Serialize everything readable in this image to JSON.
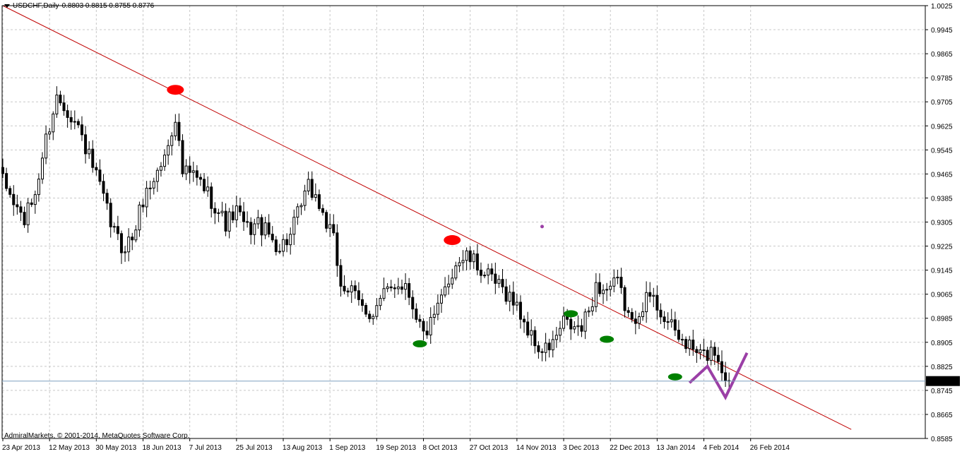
{
  "header": {
    "symbol": "USDCHF,Daily",
    "ohlc": "0.8803 0.8815 0.8755 0.8776"
  },
  "footer": {
    "copyright": "AdmiralMarkets, © 2001-2014, MetaQuotes Software Corp."
  },
  "colors": {
    "background": "#ffffff",
    "grid": "#c8c8c8",
    "candle": "#000000",
    "trendline": "#c00000",
    "resistance_marker": "#ff0000",
    "support_marker": "#008000",
    "projection": "#9b3fa6",
    "price_line": "#7f9fbf",
    "price_label_bg": "#000000",
    "price_label_text": "#ffffff"
  },
  "chart_data": {
    "type": "candlestick",
    "symbol": "USDCHF",
    "timeframe": "Daily",
    "current_price": "0.8776",
    "grid": true,
    "ylim": [
      0.8585,
      1.0025
    ],
    "y_ticks": [
      "1.0025",
      "0.9945",
      "0.9865",
      "0.9785",
      "0.9705",
      "0.9625",
      "0.9545",
      "0.9465",
      "0.9385",
      "0.9305",
      "0.9225",
      "0.9145",
      "0.9065",
      "0.8985",
      "0.8905",
      "0.8825",
      "0.8745",
      "0.8665",
      "0.8585"
    ],
    "x_ticks": [
      "23 Apr 2013",
      "12 May 2013",
      "30 May 2013",
      "18 Jun 2013",
      "7 Jul 2013",
      "25 Jul 2013",
      "13 Aug 2013",
      "1 Sep 2013",
      "19 Sep 2013",
      "8 Oct 2013",
      "27 Oct 2013",
      "14 Nov 2013",
      "3 Dec 2013",
      "22 Dec 2013",
      "13 Jan 2014",
      "4 Feb 2014",
      "26 Feb 2014"
    ],
    "x_tick_index": [
      0,
      13,
      26,
      39,
      52,
      65,
      78,
      91,
      104,
      117,
      130,
      143,
      156,
      169,
      182,
      195,
      208
    ],
    "trendline": {
      "from": {
        "bar": 0,
        "price": 1.0025
      },
      "to": {
        "bar": 236,
        "price": 0.8615
      }
    },
    "resistance_markers": [
      {
        "bar": 48,
        "price": 0.9745
      },
      {
        "bar": 125,
        "price": 0.9245
      }
    ],
    "support_markers": [
      {
        "bar": 116,
        "price": 0.89
      },
      {
        "bar": 158,
        "price": 0.9
      },
      {
        "bar": 168,
        "price": 0.8915
      },
      {
        "bar": 187,
        "price": 0.879
      }
    ],
    "stray_point": {
      "bar": 150,
      "price": 0.929
    },
    "projection": [
      {
        "bar": 191,
        "price": 0.877
      },
      {
        "bar": 196,
        "price": 0.8825
      },
      {
        "bar": 201,
        "price": 0.8722
      },
      {
        "bar": 207,
        "price": 0.887
      }
    ],
    "anchors": [
      {
        "bar": 0,
        "price": 0.944
      },
      {
        "bar": 3,
        "price": 0.937
      },
      {
        "bar": 6,
        "price": 0.931
      },
      {
        "bar": 9,
        "price": 0.94
      },
      {
        "bar": 12,
        "price": 0.958
      },
      {
        "bar": 15,
        "price": 0.972
      },
      {
        "bar": 18,
        "price": 0.968
      },
      {
        "bar": 21,
        "price": 0.962
      },
      {
        "bar": 24,
        "price": 0.952
      },
      {
        "bar": 27,
        "price": 0.942
      },
      {
        "bar": 30,
        "price": 0.93
      },
      {
        "bar": 33,
        "price": 0.922
      },
      {
        "bar": 36,
        "price": 0.925
      },
      {
        "bar": 39,
        "price": 0.938
      },
      {
        "bar": 42,
        "price": 0.945
      },
      {
        "bar": 45,
        "price": 0.952
      },
      {
        "bar": 48,
        "price": 0.966
      },
      {
        "bar": 49,
        "price": 0.956
      },
      {
        "bar": 50,
        "price": 0.947
      },
      {
        "bar": 53,
        "price": 0.946
      },
      {
        "bar": 56,
        "price": 0.942
      },
      {
        "bar": 59,
        "price": 0.936
      },
      {
        "bar": 62,
        "price": 0.93
      },
      {
        "bar": 65,
        "price": 0.934
      },
      {
        "bar": 68,
        "price": 0.928
      },
      {
        "bar": 71,
        "price": 0.93
      },
      {
        "bar": 74,
        "price": 0.926
      },
      {
        "bar": 77,
        "price": 0.922
      },
      {
        "bar": 80,
        "price": 0.926
      },
      {
        "bar": 83,
        "price": 0.936
      },
      {
        "bar": 85,
        "price": 0.942
      },
      {
        "bar": 87,
        "price": 0.939
      },
      {
        "bar": 90,
        "price": 0.93
      },
      {
        "bar": 92,
        "price": 0.924
      },
      {
        "bar": 94,
        "price": 0.91
      },
      {
        "bar": 97,
        "price": 0.907
      },
      {
        "bar": 100,
        "price": 0.902
      },
      {
        "bar": 103,
        "price": 0.9
      },
      {
        "bar": 106,
        "price": 0.906
      },
      {
        "bar": 109,
        "price": 0.91
      },
      {
        "bar": 112,
        "price": 0.91
      },
      {
        "bar": 115,
        "price": 0.9
      },
      {
        "bar": 117,
        "price": 0.893
      },
      {
        "bar": 120,
        "price": 0.898
      },
      {
        "bar": 123,
        "price": 0.908
      },
      {
        "bar": 126,
        "price": 0.917
      },
      {
        "bar": 129,
        "price": 0.919
      },
      {
        "bar": 132,
        "price": 0.916
      },
      {
        "bar": 135,
        "price": 0.912
      },
      {
        "bar": 138,
        "price": 0.909
      },
      {
        "bar": 141,
        "price": 0.906
      },
      {
        "bar": 144,
        "price": 0.9
      },
      {
        "bar": 147,
        "price": 0.892
      },
      {
        "bar": 150,
        "price": 0.887
      },
      {
        "bar": 153,
        "price": 0.89
      },
      {
        "bar": 156,
        "price": 0.897
      },
      {
        "bar": 159,
        "price": 0.895
      },
      {
        "bar": 161,
        "price": 0.895
      },
      {
        "bar": 163,
        "price": 0.901
      },
      {
        "bar": 165,
        "price": 0.909
      },
      {
        "bar": 168,
        "price": 0.908
      },
      {
        "bar": 171,
        "price": 0.91
      },
      {
        "bar": 173,
        "price": 0.903
      },
      {
        "bar": 175,
        "price": 0.896
      },
      {
        "bar": 177,
        "price": 0.902
      },
      {
        "bar": 180,
        "price": 0.906
      },
      {
        "bar": 183,
        "price": 0.901
      },
      {
        "bar": 186,
        "price": 0.895
      },
      {
        "bar": 189,
        "price": 0.891
      },
      {
        "bar": 191,
        "price": 0.889
      },
      {
        "bar": 193,
        "price": 0.887
      },
      {
        "bar": 195,
        "price": 0.886
      },
      {
        "bar": 198,
        "price": 0.888
      },
      {
        "bar": 200,
        "price": 0.882
      },
      {
        "bar": 202,
        "price": 0.8776
      }
    ]
  }
}
